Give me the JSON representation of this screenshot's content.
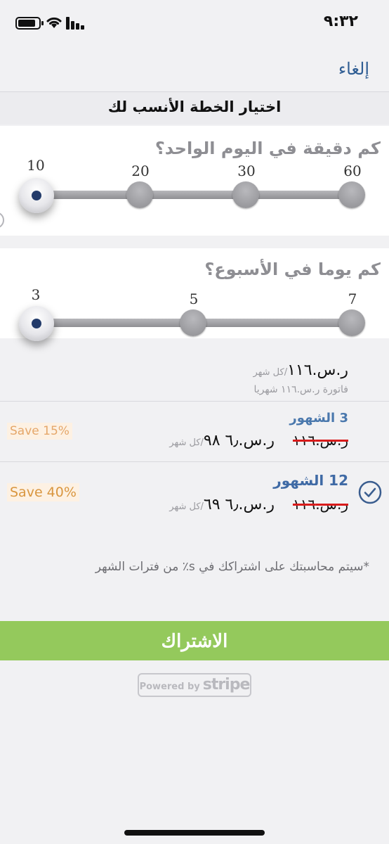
{
  "status_bar": {
    "time": "٩:٣٢"
  },
  "nav": {
    "cancel_label": "إلغاء",
    "title": "اختيار الخطة الأنسب لك"
  },
  "minutes_slider": {
    "question": "كم دقيقة في اليوم الواحد؟",
    "ticks": [
      "10",
      "20",
      "30",
      "60"
    ],
    "selected": "10"
  },
  "days_slider": {
    "question": "كم يوما في الأسبوع؟",
    "ticks": [
      "3",
      "5",
      "7"
    ],
    "selected": "3"
  },
  "summary": {
    "price": "ر.س.١١٦",
    "per": "/كل شهر",
    "billing": "فاتورة ر.س.١١٦ شهريا"
  },
  "plans": [
    {
      "name": "3 الشهور",
      "old_price": "ر.س.١١٦",
      "new_price": "ر.س.٦٫ ٩٨",
      "per": "/كل شهر",
      "save": "Save 15%",
      "selected": false
    },
    {
      "name": "12 الشهور",
      "old_price": "ر.س.١١٦",
      "new_price": "ر.س.٦٫ ٦٩",
      "per": "/كل شهر",
      "save": "Save 40%",
      "selected": true
    }
  ],
  "note": "*سيتم محاسبتك على اشتراكك في s٪ من فترات الشهر",
  "subscribe_label": "الاشتراك",
  "stripe": {
    "powered_by": "Powered by",
    "brand": "stripe"
  },
  "colors": {
    "accent_green": "#94c95c",
    "link_blue": "#2f5d93",
    "plan_blue": "#4a78ad",
    "save_orange": "#e0a35a",
    "strike_red": "#d81b1b"
  }
}
